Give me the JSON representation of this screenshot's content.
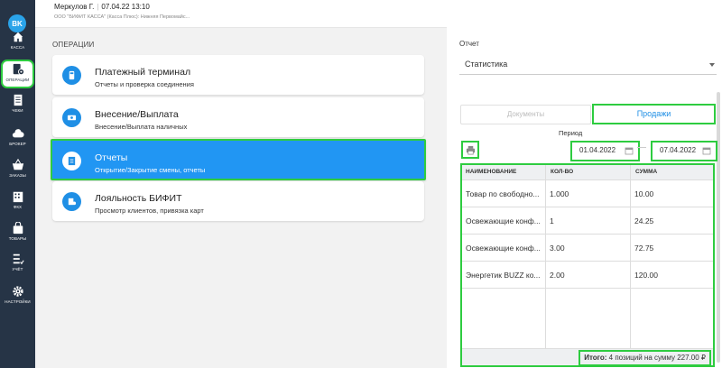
{
  "header": {
    "user": "Меркулов Г.",
    "datetime": "07.04.22 13:10",
    "org": "ООО \"БИФИТ КАССА\" (Касса Плюс): Нижняя Первомайс..."
  },
  "sidebar": {
    "avatar": "BK",
    "items": [
      {
        "label": "КАССА",
        "icon": "home-icon"
      },
      {
        "label": "ОПЕРАЦИИ",
        "icon": "operations-icon",
        "active": true
      },
      {
        "label": "ЧЕКИ",
        "icon": "receipt-icon"
      },
      {
        "label": "БРОКЕР",
        "icon": "cloud-icon"
      },
      {
        "label": "ЗАКАЗЫ",
        "icon": "basket-icon"
      },
      {
        "label": "ФКХ",
        "icon": "building-icon"
      },
      {
        "label": "ТОВАРЫ",
        "icon": "bag-icon"
      },
      {
        "label": "УЧЁТ",
        "icon": "checklist-icon"
      },
      {
        "label": "НАСТРОЙКИ",
        "icon": "gear-icon"
      }
    ]
  },
  "operations": {
    "title": "ОПЕРАЦИИ",
    "cards": [
      {
        "title": "Платежный терминал",
        "subtitle": "Отчеты и проверка соединения",
        "icon": "terminal-icon"
      },
      {
        "title": "Внесение/Выплата",
        "subtitle": "Внесение/Выплата наличных",
        "icon": "cash-icon"
      },
      {
        "title": "Отчеты",
        "subtitle": "Открытие/Закрытие смены, отчеты",
        "icon": "report-icon",
        "selected": true
      },
      {
        "title": "Лояльность БИФИТ",
        "subtitle": "Просмотр клиентов, привязка карт",
        "icon": "loyalty-icon"
      }
    ]
  },
  "report": {
    "label": "Отчет",
    "selected": "Статистика",
    "tabs": {
      "documents": "Документы",
      "sales": "Продажи"
    },
    "period_label": "Период",
    "date_from": "01.04.2022",
    "date_to": "07.04.2022",
    "table": {
      "columns": [
        "НАИМЕНОВАНИЕ",
        "КОЛ-ВО",
        "СУММА"
      ],
      "rows": [
        [
          "Товар по свободно...",
          "1.000",
          "10.00"
        ],
        [
          "Освежающие конф...",
          "1",
          "24.25"
        ],
        [
          "Освежающие конф...",
          "3.00",
          "72.75"
        ],
        [
          "Энергетик BUZZ ко...",
          "2.00",
          "120.00"
        ]
      ]
    },
    "total_label": "Итого:",
    "total_text": "4 позиций на сумму 227.00 ₽"
  },
  "colors": {
    "sidebar_bg": "#263446",
    "accent": "#2196f3",
    "highlight": "#2ecc40"
  }
}
